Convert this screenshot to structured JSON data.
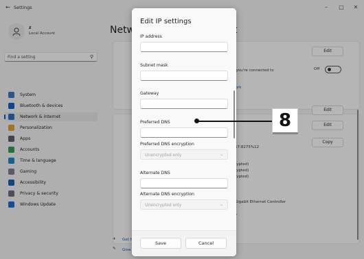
{
  "app": {
    "title": "Settings",
    "back_glyph": "←"
  },
  "window_controls": {
    "minimize": "–",
    "maximize": "□",
    "close": "✕"
  },
  "user": {
    "name": "z",
    "account_type": "Local Account"
  },
  "search": {
    "placeholder": "Find a setting"
  },
  "nav": [
    {
      "label": "System",
      "icon": "system-icon",
      "color": "#3a78c6"
    },
    {
      "label": "Bluetooth & devices",
      "icon": "bluetooth-icon",
      "color": "#0a64c8"
    },
    {
      "label": "Network & internet",
      "icon": "wifi-icon",
      "color": "#2b6dbf",
      "active": true
    },
    {
      "label": "Personalization",
      "icon": "brush-icon",
      "color": "#e0a030"
    },
    {
      "label": "Apps",
      "icon": "apps-icon",
      "color": "#5a6070"
    },
    {
      "label": "Accounts",
      "icon": "person-icon",
      "color": "#2f9d55"
    },
    {
      "label": "Time & language",
      "icon": "globe-clock-icon",
      "color": "#1e88c8"
    },
    {
      "label": "Gaming",
      "icon": "gamepad-icon",
      "color": "#7a8090"
    },
    {
      "label": "Accessibility",
      "icon": "accessibility-icon",
      "color": "#1a5fb4"
    },
    {
      "label": "Privacy & security",
      "icon": "shield-icon",
      "color": "#6a7080"
    },
    {
      "label": "Windows Update",
      "icon": "update-icon",
      "color": "#1a6fd0"
    }
  ],
  "main": {
    "title_left": "Netw",
    "title_right": "t",
    "fragments": {
      "connected": "en you're connected to",
      "network_link": "twork",
      "ipv6": "57:8275%12",
      "enc1": "rypted)",
      "enc2": "rypted)",
      "enc3": "rypted)",
      "adapter": "Gigabit Ethernet Controller",
      "f": "F",
      "get": "Get h",
      "give": "Give"
    },
    "edit_label": "Edit",
    "copy_label": "Copy",
    "toggle_label": "Off"
  },
  "dialog": {
    "title": "Edit IP settings",
    "fields": {
      "ip_address": {
        "label": "IP address",
        "value": ""
      },
      "subnet_mask": {
        "label": "Subnet mask",
        "value": ""
      },
      "gateway": {
        "label": "Gateway",
        "value": ""
      },
      "preferred_dns": {
        "label": "Preferred DNS",
        "value": ""
      },
      "preferred_dns_encryption": {
        "label": "Preferred DNS encryption",
        "value": "Unencrypted only"
      },
      "alternate_dns": {
        "label": "Alternate DNS",
        "value": ""
      },
      "alternate_dns_encryption": {
        "label": "Alternate DNS encryption",
        "value": "Unencrypted only"
      }
    },
    "save_label": "Save",
    "cancel_label": "Cancel"
  },
  "callout": {
    "number": "8"
  }
}
